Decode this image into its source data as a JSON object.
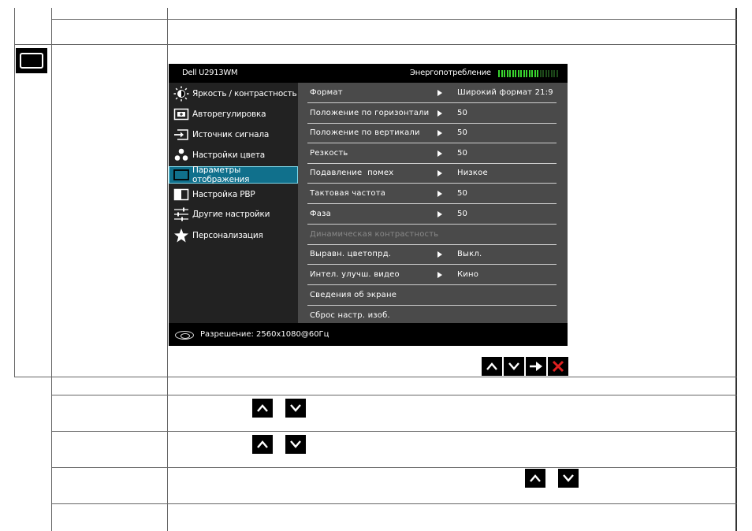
{
  "osd": {
    "model": "Dell U2913WM",
    "energy_label": "Энергопотребление",
    "energy_level": 0.7,
    "left_menu": [
      {
        "label": "Яркость / контрастность",
        "icon": "brightness-icon"
      },
      {
        "label": "Авторегулировка",
        "icon": "auto-adjust-icon"
      },
      {
        "label": "Источник сигнала",
        "icon": "input-source-icon"
      },
      {
        "label": "Настройки цвета",
        "icon": "color-settings-icon"
      },
      {
        "label": "Параметры отображения",
        "icon": "display-settings-icon",
        "selected": true
      },
      {
        "label": "Настройка PBP",
        "icon": "pbp-icon"
      },
      {
        "label": "Другие настройки",
        "icon": "other-settings-icon"
      },
      {
        "label": "Персонализация",
        "icon": "star-icon"
      }
    ],
    "right_menu": [
      {
        "label": "Формат",
        "value": "Широкий формат 21:9"
      },
      {
        "label": "Положение по горизонтали",
        "value": "50"
      },
      {
        "label": "Положение по вертикали",
        "value": "50"
      },
      {
        "label": "Резкость",
        "value": "50"
      },
      {
        "label": "Подавление  помех",
        "value": "Низкое"
      },
      {
        "label": "Тактовая частота",
        "value": "50"
      },
      {
        "label": "Фаза",
        "value": "50"
      },
      {
        "label": "Динамическая контрастность",
        "value": "",
        "disabled": true
      },
      {
        "label": "Выравн. цветопрд.",
        "value": "Выкл."
      },
      {
        "label": "Интел. улучш. видео",
        "value": "Кино"
      },
      {
        "label": "Сведения об экране",
        "value": ""
      },
      {
        "label": "Сброс настр. изоб.",
        "value": ""
      }
    ],
    "resolution_text": "Разрешение: 2560x1080@60Гц"
  },
  "colors": {
    "osd_background": "#000000",
    "left_panel": "#222222",
    "right_panel": "#4a4a4a",
    "selected_item": "#10708c",
    "energy_green": "#39d52f",
    "close_red": "#e02020"
  },
  "nav_buttons": [
    "up-icon",
    "down-icon",
    "right-arrow-icon",
    "close-icon"
  ]
}
